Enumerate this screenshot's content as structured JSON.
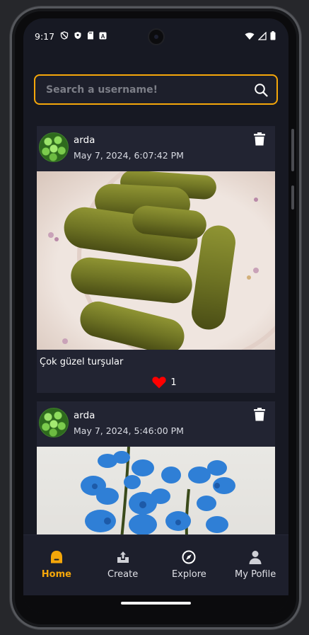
{
  "status_bar": {
    "time": "9:17"
  },
  "search": {
    "placeholder": "Search a username!"
  },
  "posts": [
    {
      "username": "arda",
      "timestamp": "May 7, 2024, 6:07:42 PM",
      "caption": "Çok güzel turşular",
      "likes": "1"
    },
    {
      "username": "arda",
      "timestamp": "May 7, 2024, 5:46:00 PM"
    }
  ],
  "nav": {
    "items": [
      {
        "label": "Home",
        "icon": "home-icon",
        "active": true
      },
      {
        "label": "Create",
        "icon": "upload-icon"
      },
      {
        "label": "Explore",
        "icon": "compass-icon"
      },
      {
        "label": "My Pofile",
        "icon": "person-icon"
      }
    ]
  },
  "colors": {
    "accent": "#f5a70a",
    "background": "#171923",
    "card": "#222432",
    "heart": "#ff0000"
  }
}
